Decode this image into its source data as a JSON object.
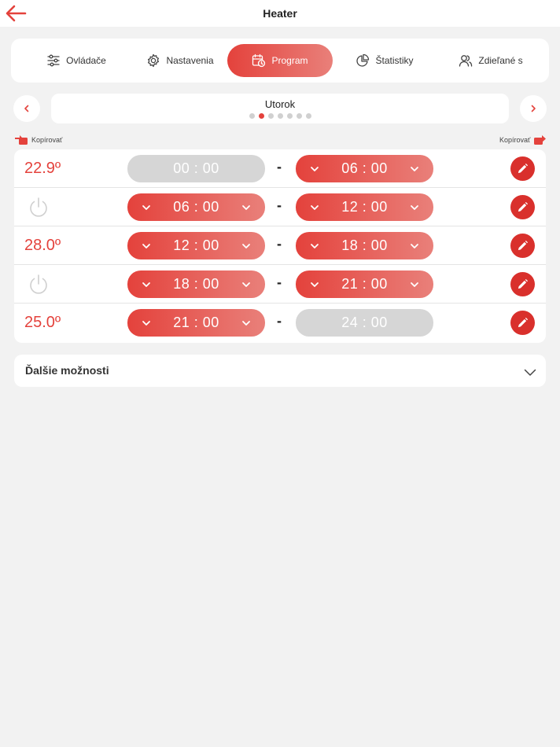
{
  "header": {
    "title": "Heater"
  },
  "tabs": [
    {
      "label": "Ovládače",
      "icon": "sliders-icon"
    },
    {
      "label": "Nastavenia",
      "icon": "gear-icon"
    },
    {
      "label": "Program",
      "icon": "calendar-clock-icon",
      "active": true
    },
    {
      "label": "Štatistiky",
      "icon": "pie-chart-icon"
    },
    {
      "label": "Zdieľané s",
      "icon": "users-icon"
    }
  ],
  "day": {
    "name": "Utorok",
    "dot_count": 7,
    "active_dot": 2
  },
  "copy": {
    "left_label": "Kopírovať",
    "right_label": "Kopírovať"
  },
  "schedule": [
    {
      "temp": "22.9º",
      "start": "00 : 00",
      "end": "06 : 00"
    },
    {
      "temp": "",
      "off": true,
      "start": "06 : 00",
      "end": "12 : 00"
    },
    {
      "temp": "28.0º",
      "start": "12 : 00",
      "end": "18 : 00"
    },
    {
      "temp": "",
      "off": true,
      "start": "18 : 00",
      "end": "21 : 00"
    },
    {
      "temp": "25.0º",
      "start": "21 : 00",
      "end": "24 : 00"
    }
  ],
  "separator": "-",
  "more": {
    "label": "Ďalšie možnosti"
  },
  "colors": {
    "accent": "#e4423c",
    "accent_light": "#e9807a",
    "edit": "#d9302c",
    "disabled": "#d6d6d6"
  }
}
